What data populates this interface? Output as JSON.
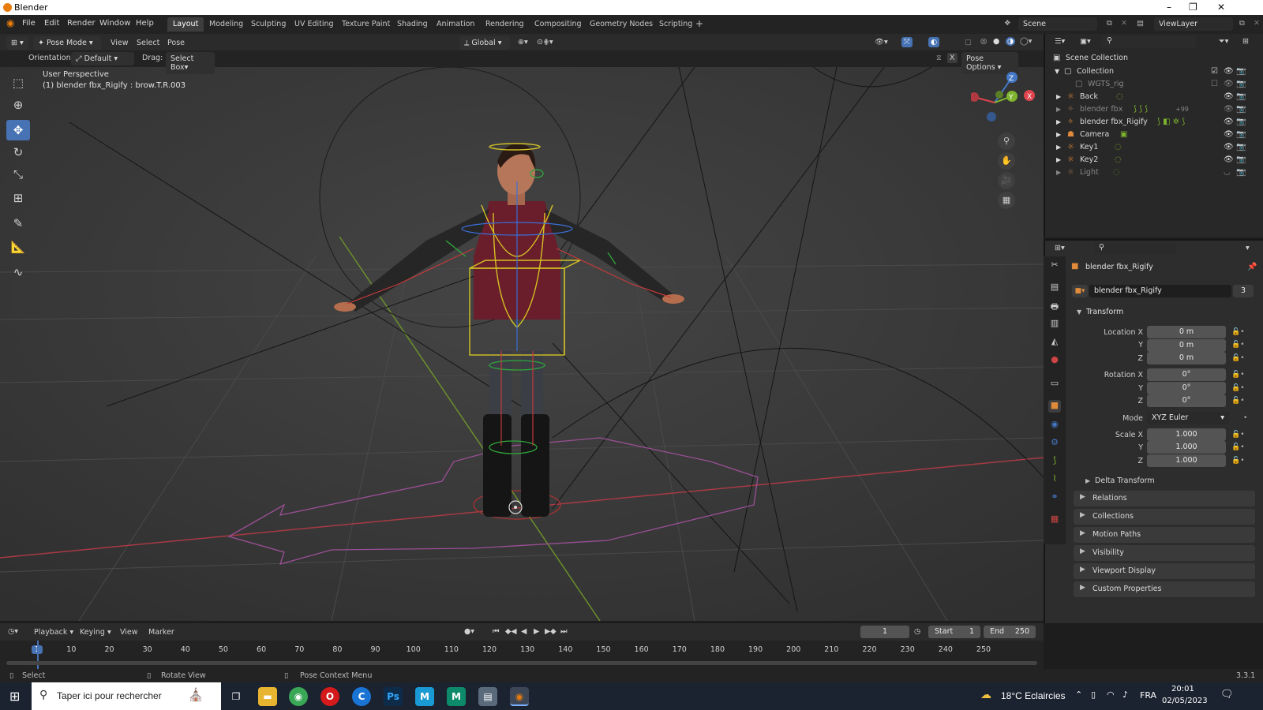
{
  "window": {
    "title": "Blender",
    "controls": [
      "–",
      "❐",
      "✕"
    ]
  },
  "menu": [
    "File",
    "Edit",
    "Render",
    "Window",
    "Help"
  ],
  "workspaces": [
    {
      "label": "Layout",
      "active": true
    },
    {
      "label": "Modeling"
    },
    {
      "label": "Sculpting"
    },
    {
      "label": "UV Editing"
    },
    {
      "label": "Texture Paint"
    },
    {
      "label": "Shading"
    },
    {
      "label": "Animation"
    },
    {
      "label": "Rendering"
    },
    {
      "label": "Compositing"
    },
    {
      "label": "Geometry Nodes"
    },
    {
      "label": "Scripting"
    }
  ],
  "add_workspace": "+",
  "scene": {
    "name": "Scene",
    "view_layer": "ViewLayer"
  },
  "viewport_header": {
    "mode": "Pose Mode",
    "menus": [
      "View",
      "Select",
      "Pose"
    ],
    "transform_space": "Global",
    "orientation_label": "Orientation:",
    "orientation_value": "Default",
    "drag_label": "Drag:",
    "drag_value": "Select Box",
    "pose_options": "Pose Options",
    "x_mirror": "X"
  },
  "viewport": {
    "perspective": "User Perspective",
    "active_item": "(1) blender fbx_Rigify : brow.T.R.003",
    "gizmo_axes": {
      "x": "X",
      "y": "Y",
      "z": "Z"
    }
  },
  "outliner": {
    "root": "Scene Collection",
    "collection": "Collection",
    "items": [
      {
        "name": "WGTS_rig",
        "dim": true
      },
      {
        "name": "Back"
      },
      {
        "name": "blender fbx",
        "dim": true,
        "badge": "+99"
      },
      {
        "name": "blender fbx_Rigify"
      },
      {
        "name": "Camera"
      },
      {
        "name": "Key1"
      },
      {
        "name": "Key2"
      },
      {
        "name": "Light",
        "dim": true
      }
    ]
  },
  "properties": {
    "object_name": "blender fbx_Rigify",
    "data_name": "blender fbx_Rigify",
    "users": "3",
    "transform_header": "Transform",
    "location_label": "Location X",
    "rotation_label": "Rotation X",
    "scale_label": "Scale X",
    "axis_y": "Y",
    "axis_z": "Z",
    "location": [
      "0 m",
      "0 m",
      "0 m"
    ],
    "rotation": [
      "0°",
      "0°",
      "0°"
    ],
    "mode_label": "Mode",
    "mode_value": "XYZ Euler",
    "scale": [
      "1.000",
      "1.000",
      "1.000"
    ],
    "delta_transform": "Delta Transform",
    "panels": [
      "Relations",
      "Collections",
      "Motion Paths",
      "Visibility",
      "Viewport Display",
      "Custom Properties"
    ]
  },
  "timeline": {
    "menus": [
      "Playback",
      "Keying",
      "View",
      "Marker"
    ],
    "current_frame": "1",
    "start_label": "Start",
    "start": "1",
    "end_label": "End",
    "end": "250",
    "ticks": [
      "1",
      "10",
      "20",
      "30",
      "40",
      "50",
      "60",
      "70",
      "80",
      "90",
      "100",
      "110",
      "120",
      "130",
      "140",
      "150",
      "160",
      "170",
      "180",
      "190",
      "200",
      "210",
      "220",
      "230",
      "240",
      "250"
    ]
  },
  "statusbar": {
    "select": "Select",
    "rotate": "Rotate View",
    "context": "Pose Context Menu",
    "version": "3.3.1"
  },
  "taskbar": {
    "search_placeholder": "Taper ici pour rechercher",
    "weather": "18°C Eclaircies",
    "language": "FRA",
    "time": "20:01",
    "date": "02/05/2023"
  },
  "colors": {
    "accent": "#4772b3",
    "blender_orange": "#e87d0d",
    "x_axis": "#e0454e",
    "y_axis": "#7fb52e",
    "z_axis": "#4478c5"
  }
}
